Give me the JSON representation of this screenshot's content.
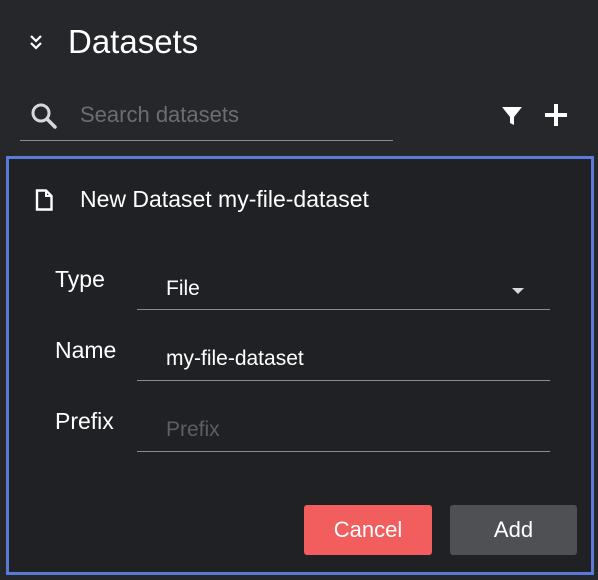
{
  "header": {
    "title": "Datasets",
    "collapse_icon": "double-chevron-down-icon"
  },
  "search": {
    "placeholder": "Search datasets",
    "value": "",
    "icon": "search-icon"
  },
  "toolbar": {
    "filter_icon": "filter-icon",
    "add_icon": "plus-icon"
  },
  "form": {
    "title": "New Dataset my-file-dataset",
    "icon": "document-icon",
    "fields": {
      "type": {
        "label": "Type",
        "value": "File"
      },
      "name": {
        "label": "Name",
        "value": "my-file-dataset",
        "placeholder": ""
      },
      "prefix": {
        "label": "Prefix",
        "value": "",
        "placeholder": "Prefix"
      }
    },
    "buttons": {
      "cancel": "Cancel",
      "add": "Add"
    }
  },
  "colors": {
    "background": "#26272b",
    "form_background": "#202124",
    "form_border": "#5b79d6",
    "cancel_button": "#f25d5d",
    "add_button": "#4e5054",
    "placeholder_text": "#6c6d72"
  }
}
